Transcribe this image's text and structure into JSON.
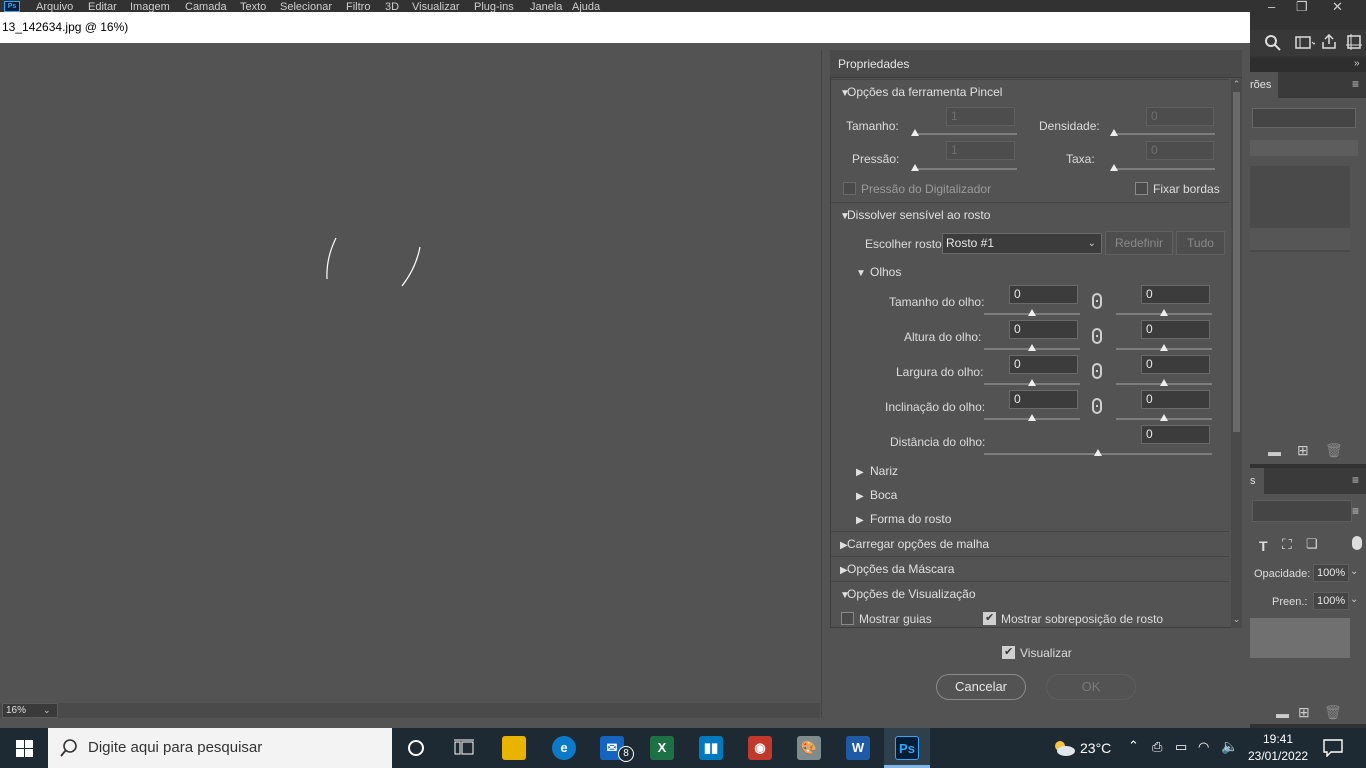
{
  "ps_menu": {
    "items": [
      "Arquivo",
      "Editar",
      "Imagem",
      "Camada",
      "Texto",
      "Selecionar",
      "Filtro",
      "3D",
      "Visualizar",
      "Plug-ins",
      "Janela",
      "Ajuda"
    ]
  },
  "dialog": {
    "title": "13_142634.jpg @ 16%)",
    "zoom": "16%"
  },
  "properties": {
    "title": "Propriedades",
    "brush_section": {
      "title": "Opções da ferramenta Pincel",
      "size_label": "Tamanho:",
      "size_value": "1",
      "density_label": "Densidade:",
      "density_value": "0",
      "pressure_label": "Pressão:",
      "pressure_value": "1",
      "rate_label": "Taxa:",
      "rate_value": "0",
      "stylus_label": "Pressão do Digitalizador",
      "pin_edges_label": "Fixar bordas"
    },
    "face_section": {
      "title": "Dissolver sensível ao rosto",
      "select_face_label": "Escolher rosto:",
      "select_face_value": "Rosto #1",
      "reset_label": "Redefinir",
      "all_label": "Tudo",
      "eyes_title": "Olhos",
      "eye_size_label": "Tamanho do olho:",
      "eye_height_label": "Altura do olho:",
      "eye_width_label": "Largura do olho:",
      "eye_tilt_label": "Inclinação do olho:",
      "eye_distance_label": "Distância do olho:",
      "eye_size_left": "0",
      "eye_size_right": "0",
      "eye_height_left": "0",
      "eye_height_right": "0",
      "eye_width_left": "0",
      "eye_width_right": "0",
      "eye_tilt_left": "0",
      "eye_tilt_right": "0",
      "eye_distance": "0",
      "nose_title": "Nariz",
      "mouth_title": "Boca",
      "face_shape_title": "Forma do rosto"
    },
    "mesh_section": {
      "title": "Carregar opções de malha"
    },
    "mask_section": {
      "title": "Opções da Máscara"
    },
    "view_section": {
      "title": "Opções de Visualização",
      "show_guides_label": "Mostrar guias",
      "show_face_overlay_label": "Mostrar sobreposição de rosto"
    }
  },
  "footer": {
    "preview_label": "Visualizar",
    "cancel_label": "Cancelar",
    "ok_label": "OK"
  },
  "right_panels": {
    "tab_fragment": "rões",
    "tab_fragment2": "s",
    "opacity_label": "Opacidade:",
    "opacity_value": "100%",
    "fill_label": "Preen.:",
    "fill_value": "100%"
  },
  "taskbar": {
    "search_placeholder": "Digite aqui para pesquisar",
    "mail_badge": "8",
    "temperature": "23°C",
    "time": "19:41",
    "date": "23/01/2022"
  }
}
